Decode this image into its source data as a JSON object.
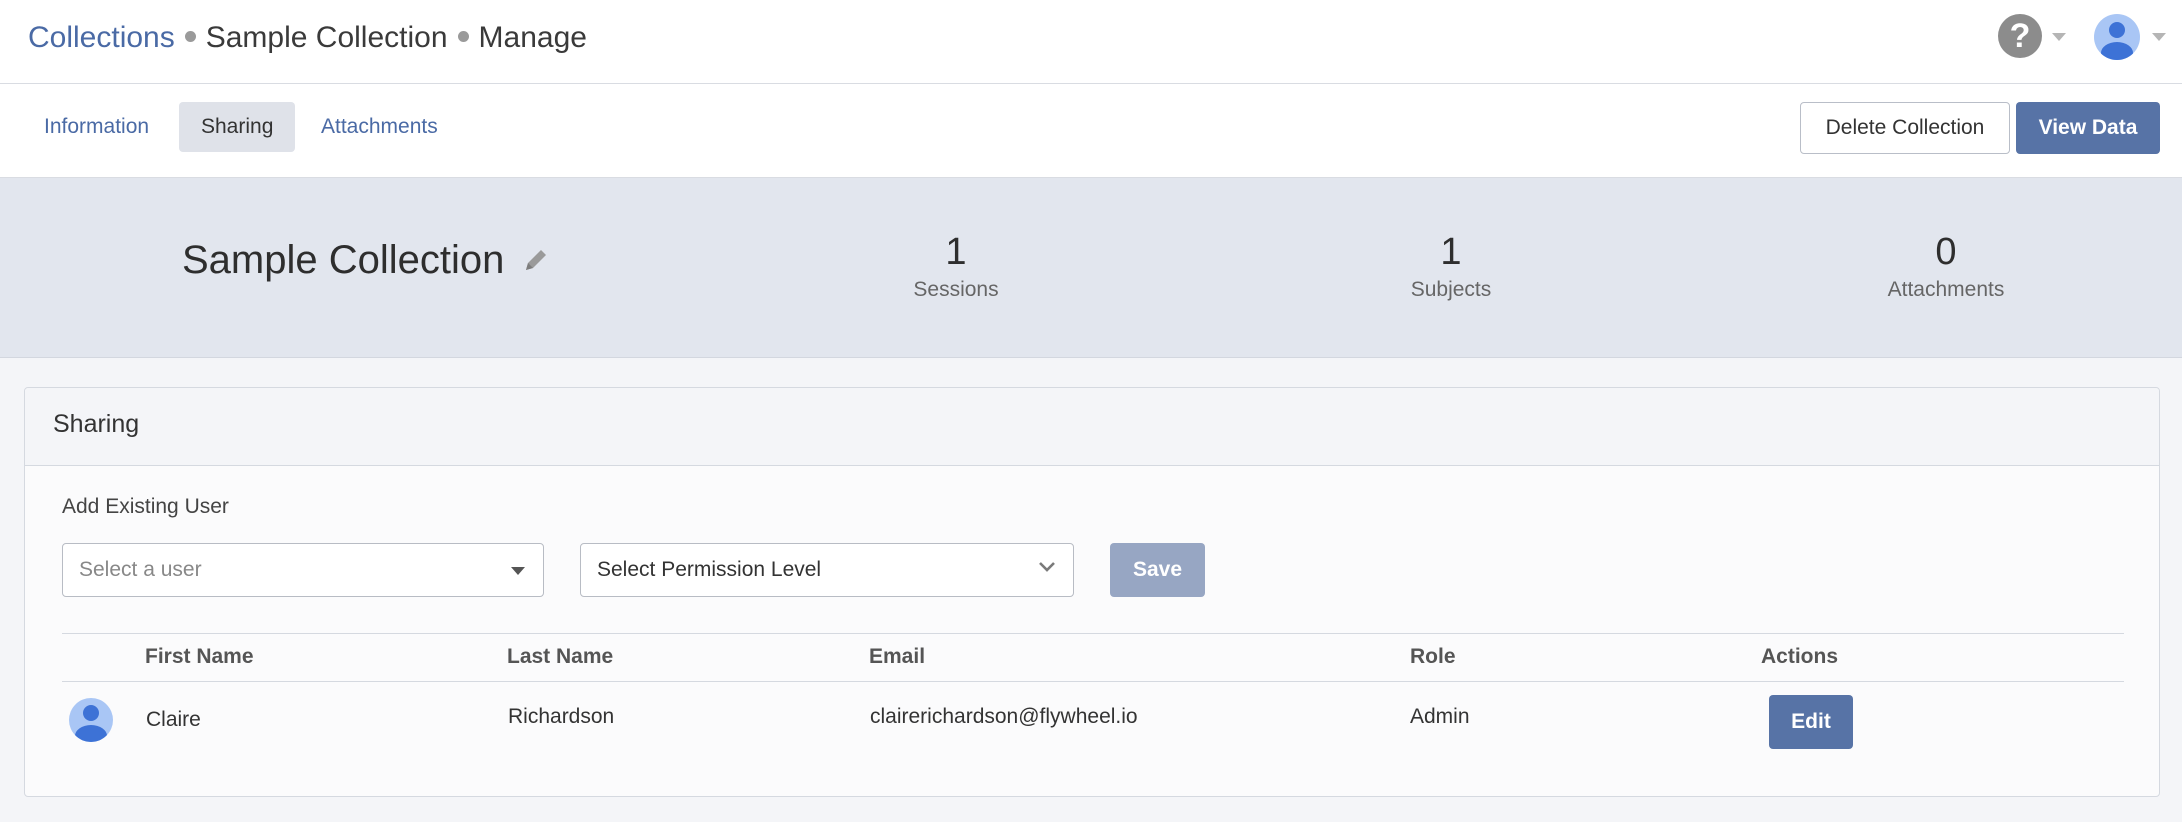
{
  "header": {
    "breadcrumb": [
      "Collections",
      "Sample Collection",
      "Manage"
    ],
    "help_icon_glyph": "?",
    "help_icon": "help-icon",
    "user_icon": "user-avatar-icon"
  },
  "tabs": {
    "items": [
      "Information",
      "Sharing",
      "Attachments"
    ],
    "active": "Sharing"
  },
  "actions": {
    "delete_label": "Delete Collection",
    "view_label": "View Data"
  },
  "summary": {
    "collection_name": "Sample Collection",
    "stats": [
      {
        "value": "1",
        "label": "Sessions"
      },
      {
        "value": "1",
        "label": "Subjects"
      },
      {
        "value": "0",
        "label": "Attachments"
      }
    ]
  },
  "sharing": {
    "title": "Sharing",
    "add_label": "Add Existing User",
    "user_placeholder": "Select a user",
    "permission_placeholder": "Select Permission Level",
    "save_label": "Save",
    "columns": [
      "First Name",
      "Last Name",
      "Email",
      "Role",
      "Actions"
    ],
    "rows": [
      {
        "first": "Claire",
        "last": "Richardson",
        "email": "clairerichardson@flywheel.io",
        "role": "Admin",
        "action": "Edit"
      }
    ]
  },
  "colors": {
    "accent": "#5773a6",
    "link": "#4a6aa5",
    "summary_bg": "#e2e6ee"
  }
}
